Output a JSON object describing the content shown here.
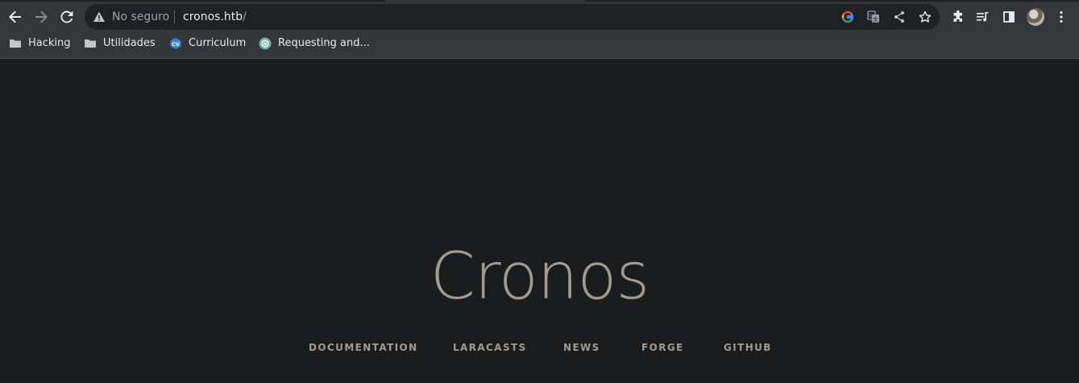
{
  "browser": {
    "omnibox": {
      "security_label": "No seguro",
      "url_host": "cronos.htb",
      "url_path": "/"
    },
    "bookmarks": [
      {
        "label": "Hacking",
        "icon": "folder-icon"
      },
      {
        "label": "Utilidades",
        "icon": "folder-icon"
      },
      {
        "label": "Curriculum",
        "icon": "cv-icon"
      },
      {
        "label": "Requesting and...",
        "icon": "openai-icon"
      }
    ]
  },
  "page": {
    "title": "Cronos",
    "links": [
      "DOCUMENTATION",
      "LARACASTS",
      "NEWS",
      "FORGE",
      "GITHUB"
    ]
  },
  "colors": {
    "toolbar_bg": "#35363a",
    "omnibox_bg": "#202124",
    "page_bg": "#1b1c1e",
    "title_text": "#a19a90"
  }
}
